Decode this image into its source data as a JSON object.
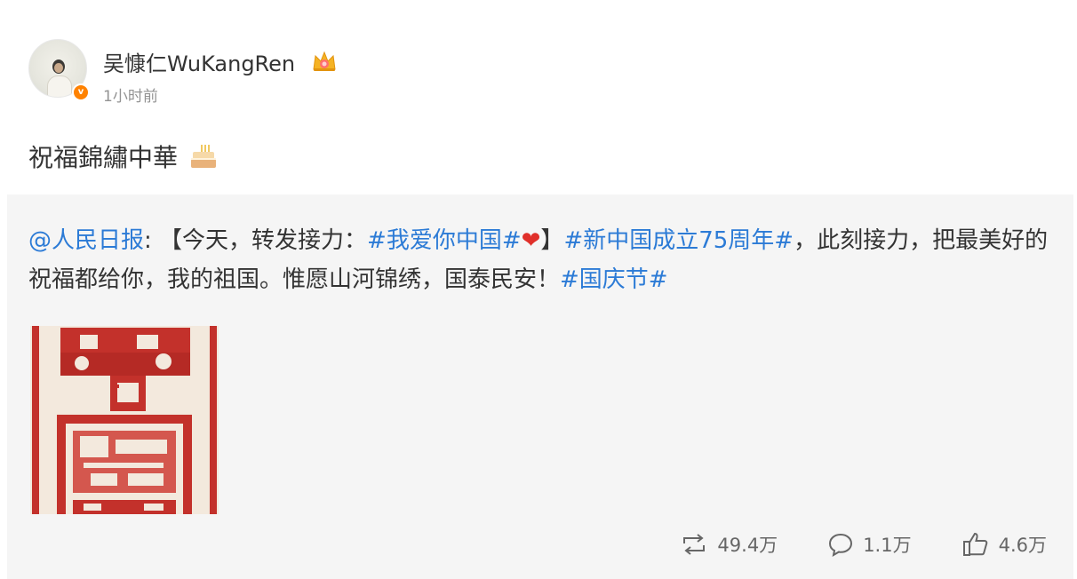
{
  "author": {
    "name": "吴慷仁WuKangRen",
    "time": "1小时前",
    "verified_icon": "v-badge-icon",
    "level_icon": "crown-icon",
    "accent": "#ff8200"
  },
  "post": {
    "text": "祝福錦繡中華",
    "emoji_icon": "cake-icon"
  },
  "repost": {
    "mention": "@人民日报",
    "colon": ": 【今天，转发接力：",
    "tag1": "#我爱你中国#",
    "heart": "❤",
    "bracket_close": "】",
    "tag2": "#新中国成立75周年#",
    "body": "，此刻接力，把最美好的祝福都给你，我的祖国。惟愿山河锦绣，国泰民安！",
    "tag3": "#国庆节#",
    "link_color": "#2c7bd6"
  },
  "stats": {
    "repost_count": "49.4万",
    "comment_count": "1.1万",
    "like_count": "4.6万"
  }
}
